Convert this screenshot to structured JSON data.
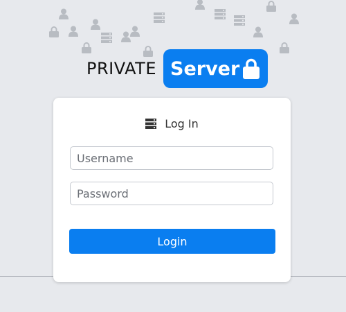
{
  "logo": {
    "private_text": "PRIVATE",
    "server_text": "Server",
    "lock_icon": "lock-icon",
    "badge_color": "#0a7ef0"
  },
  "login_card": {
    "header_icon": "server-stack-icon",
    "title": "Log In",
    "username_placeholder": "Username",
    "password_placeholder": "Password",
    "username_value": "",
    "password_value": "",
    "login_label": "Login",
    "button_color": "#0a7ef0"
  },
  "background": {
    "color": "#e7e9ed",
    "decor_icons": [
      "user-icon",
      "server-icon",
      "lock-icon"
    ]
  }
}
